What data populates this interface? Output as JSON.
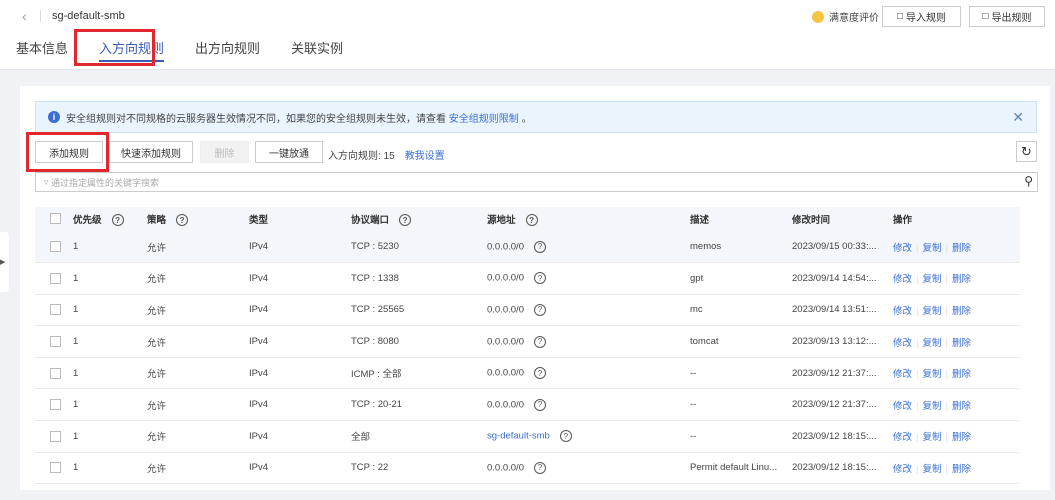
{
  "header": {
    "title": "sg-default-smb",
    "tabs": [
      "基本信息",
      "入方向规则",
      "出方向规则",
      "关联实例"
    ],
    "active_tab": 1,
    "rating": "满意度评价",
    "import": "导入规则",
    "export": "导出规则"
  },
  "alert": {
    "text": "安全组规则对不同规格的云服务器生效情况不同，如果您的安全组规则未生效，请查看",
    "link": "安全组规则限制",
    "end": "。"
  },
  "toolbar": {
    "add": "添加规则",
    "quick_add": "快速添加规则",
    "delete": "删除",
    "open_all": "一键放通",
    "count_label": "入方向规则: 15",
    "help": "教我设置"
  },
  "search": {
    "placeholder": "通过指定属性的关键字搜索"
  },
  "table": {
    "headers": [
      "优先级",
      "策略",
      "类型",
      "协议端口",
      "源地址",
      "描述",
      "修改时间",
      "操作"
    ],
    "actions": [
      "修改",
      "复制",
      "删除"
    ],
    "rows": [
      {
        "priority": "1",
        "policy": "允许",
        "type": "IPv4",
        "port": "TCP : 5230",
        "source": "0.0.0.0/0",
        "desc": "memos",
        "time": "2023/09/15 00:33:..."
      },
      {
        "priority": "1",
        "policy": "允许",
        "type": "IPv4",
        "port": "TCP : 1338",
        "source": "0.0.0.0/0",
        "desc": "gpt",
        "time": "2023/09/14 14:54:..."
      },
      {
        "priority": "1",
        "policy": "允许",
        "type": "IPv4",
        "port": "TCP : 25565",
        "source": "0.0.0.0/0",
        "desc": "mc",
        "time": "2023/09/14 13:51:..."
      },
      {
        "priority": "1",
        "policy": "允许",
        "type": "IPv4",
        "port": "TCP : 8080",
        "source": "0.0.0.0/0",
        "desc": "tomcat",
        "time": "2023/09/13 13:12:..."
      },
      {
        "priority": "1",
        "policy": "允许",
        "type": "IPv4",
        "port": "ICMP : 全部",
        "source": "0.0.0.0/0",
        "desc": "--",
        "time": "2023/09/12 21:37:..."
      },
      {
        "priority": "1",
        "policy": "允许",
        "type": "IPv4",
        "port": "TCP : 20-21",
        "source": "0.0.0.0/0",
        "desc": "--",
        "time": "2023/09/12 21:37:..."
      },
      {
        "priority": "1",
        "policy": "允许",
        "type": "IPv4",
        "port": "全部",
        "source": "sg-default-smb",
        "source_link": true,
        "desc": "--",
        "time": "2023/09/12 18:15:..."
      },
      {
        "priority": "1",
        "policy": "允许",
        "type": "IPv4",
        "port": "TCP : 22",
        "source": "0.0.0.0/0",
        "desc": "Permit default Linu...",
        "time": "2023/09/12 18:15:..."
      }
    ]
  }
}
